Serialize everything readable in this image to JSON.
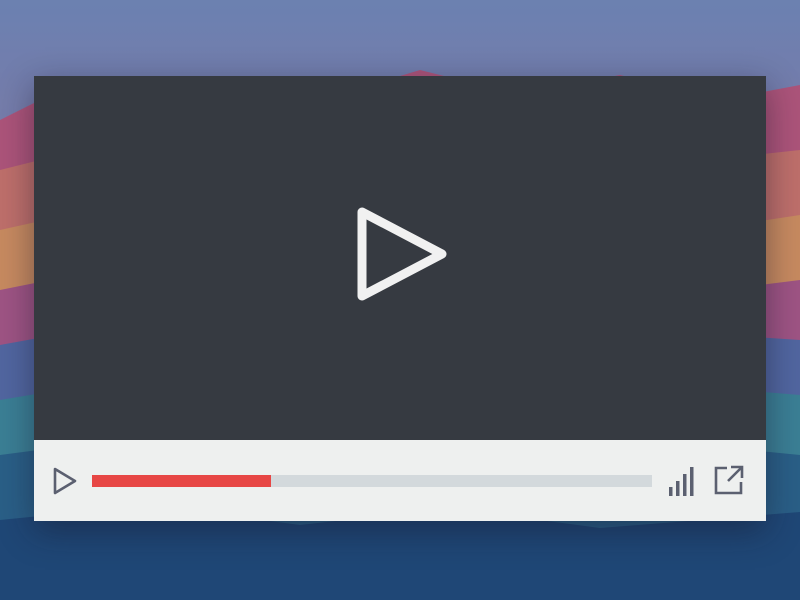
{
  "player": {
    "state": "paused",
    "progress_fraction": 0.32
  },
  "icons": {
    "big_play": "play-icon",
    "control_play": "play-icon",
    "volume": "signal-bars-icon",
    "external": "external-link-icon"
  },
  "colors": {
    "video_background": "#363a41",
    "control_bar": "#eef0ef",
    "progress_fill": "#e74745",
    "progress_track": "#d3d9dc",
    "icon": "#5b6070",
    "big_play_icon": "#f1f1f1"
  }
}
